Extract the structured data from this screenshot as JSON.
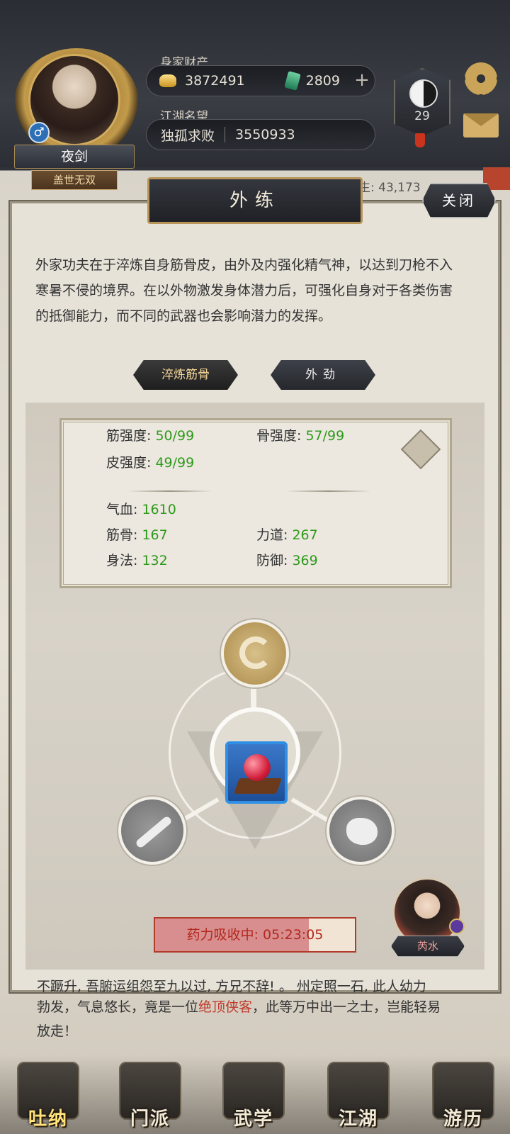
{
  "header": {
    "player_name": "夜剑",
    "player_title": "盖世无双",
    "wealth_label": "身家财产",
    "gold": "3872491",
    "jade": "2809",
    "plus": "+",
    "reputation_label": "江湖名望",
    "reputation_title": "独孤求败",
    "reputation_value": "3550933",
    "taichi_level": "29",
    "partial_right_text": "生: 43,173"
  },
  "modal": {
    "title": "外练",
    "close_label": "关闭",
    "description": "外家功夫在于淬炼自身筋骨皮，由外及内强化精气神，以达到刀枪不入寒暑不侵的境界。在以外物激发身体潜力后，可强化自身对于各类伤害的抵御能力，而不同的武器也会影响潜力的发挥。",
    "tabs": [
      {
        "label": "淬炼筋骨",
        "active": true
      },
      {
        "label": "外劲",
        "active": false
      }
    ],
    "stats": {
      "tendon": {
        "label": "筋强度:",
        "value": "50/99"
      },
      "bone": {
        "label": "骨强度:",
        "value": "57/99"
      },
      "skin": {
        "label": "皮强度:",
        "value": "49/99"
      },
      "qixue": {
        "label": "气血:",
        "value": "1610"
      },
      "jingu": {
        "label": "筋骨:",
        "value": "167"
      },
      "lidao": {
        "label": "力道:",
        "value": "267"
      },
      "shenfa": {
        "label": "身法:",
        "value": "132"
      },
      "fangyu": {
        "label": "防御:",
        "value": "369"
      }
    },
    "timer": {
      "label": "药力吸收中: 05:23:05",
      "progress": 0.77
    },
    "npc_name": "芮水"
  },
  "story": {
    "top_line": "不蹶升, 吾腑运组怨至九以过, 方兄不辞! 。 州定照一石, 此人幼力",
    "line1": "勃发，气息悠长，竟是一位",
    "highlight": "绝顶侠客",
    "line1_tail": "，此等万中出一之士，岂能轻易",
    "line2": "放走！"
  },
  "bottom_nav": [
    {
      "label": "吐纳",
      "active": true
    },
    {
      "label": "门派",
      "active": false
    },
    {
      "label": "武学",
      "active": false
    },
    {
      "label": "江湖",
      "active": false
    },
    {
      "label": "游历",
      "active": false
    }
  ],
  "colors": {
    "stat_value_green": "#2e9a1c",
    "timer_red": "#b3281d",
    "accent_gold": "#b89458",
    "highlight_red": "#c0392b"
  }
}
